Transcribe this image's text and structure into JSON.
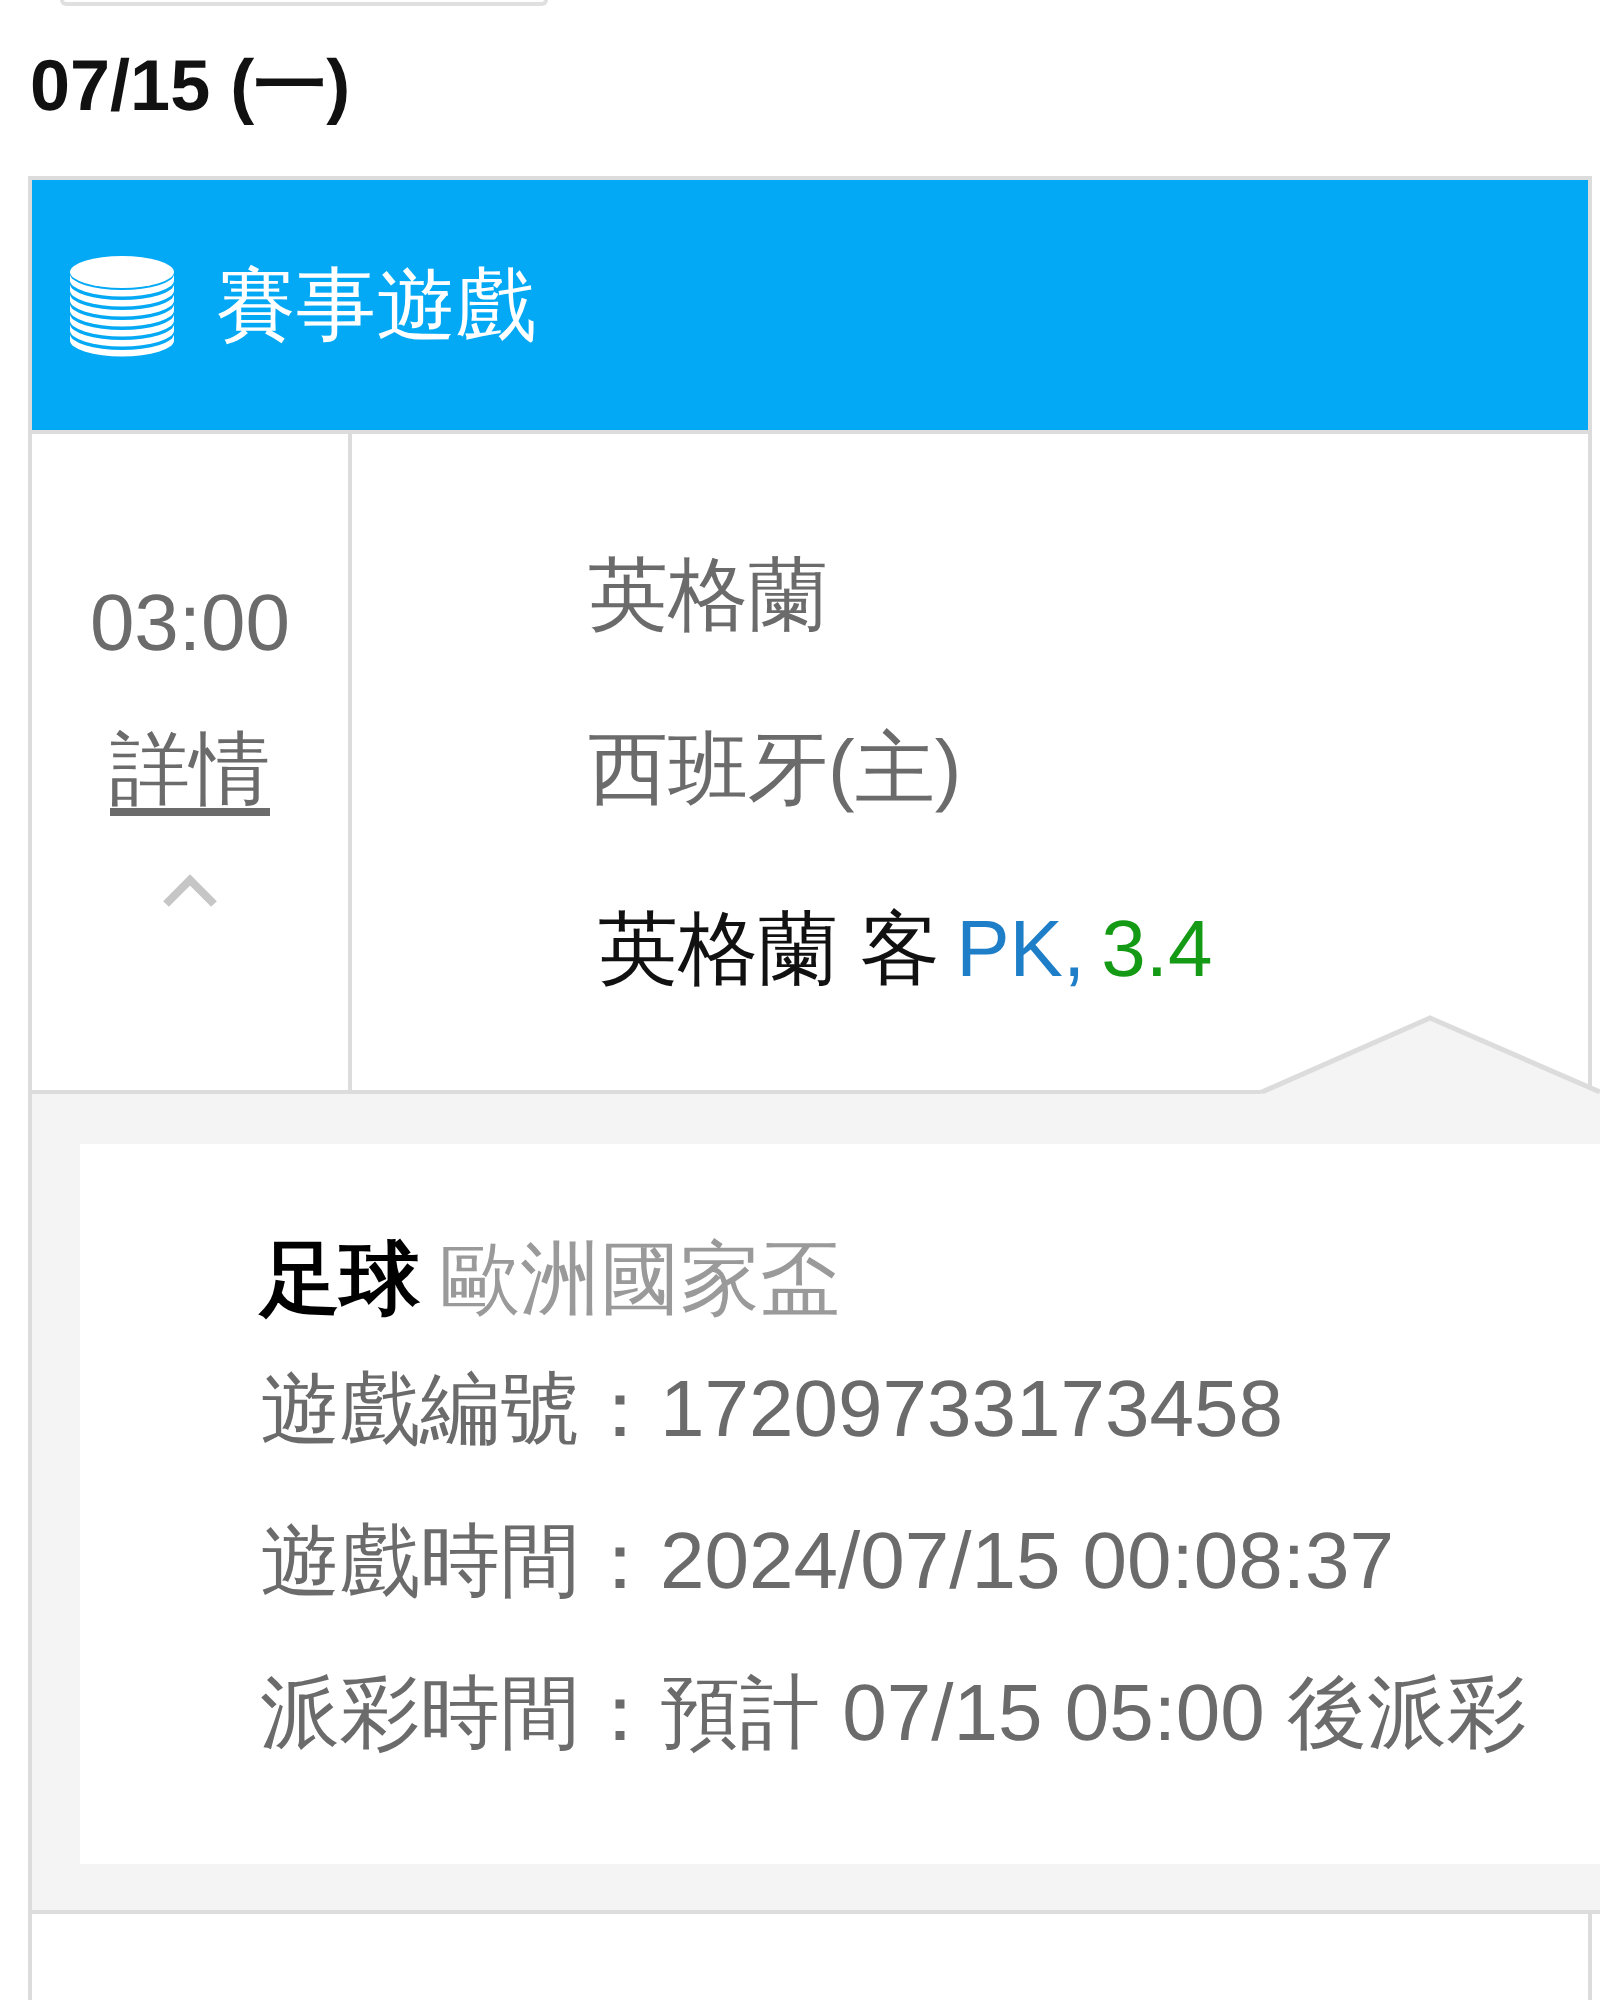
{
  "date_header": "07/15 (一)",
  "card": {
    "title": "賽事遊戲",
    "match": {
      "time": "03:00",
      "details_link": "詳情",
      "expanded": true,
      "teams": [
        "英格蘭",
        "西班牙(主)"
      ],
      "bet": {
        "selection": "英格蘭 客",
        "handicap": "PK,",
        "odds": "3.4"
      }
    },
    "detail": {
      "sport": "足球",
      "league": "歐洲國家盃",
      "lines": [
        {
          "label": "遊戲編號：",
          "value": "17209733173458"
        },
        {
          "label": "遊戲時間：",
          "value": "2024/07/15 00:08:37"
        },
        {
          "label": "派彩時間：",
          "value": "預計 07/15 05:00 後派彩"
        }
      ]
    }
  }
}
